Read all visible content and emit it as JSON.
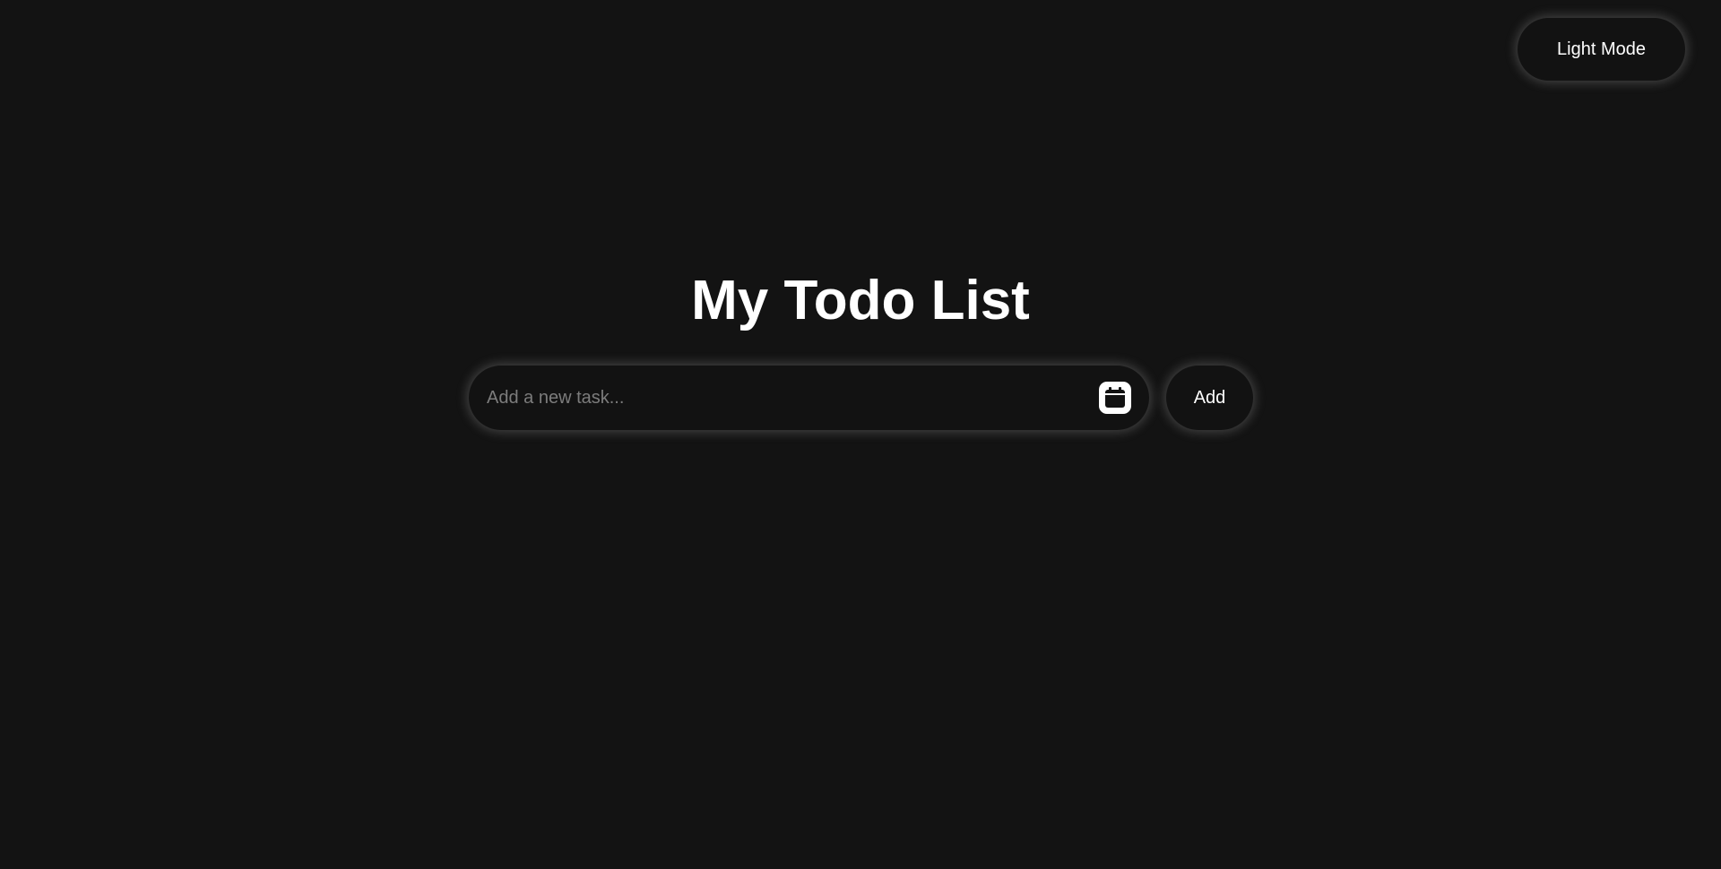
{
  "header": {
    "theme_toggle_label": "Light Mode"
  },
  "main": {
    "title": "My Todo List",
    "task_input": {
      "placeholder": "Add a new task...",
      "value": ""
    },
    "calendar_icon": "calendar-icon",
    "add_label": "Add"
  },
  "colors": {
    "background": "#131313",
    "surface": "#121212",
    "text": "#ffffff",
    "placeholder": "#7c7c7c"
  }
}
